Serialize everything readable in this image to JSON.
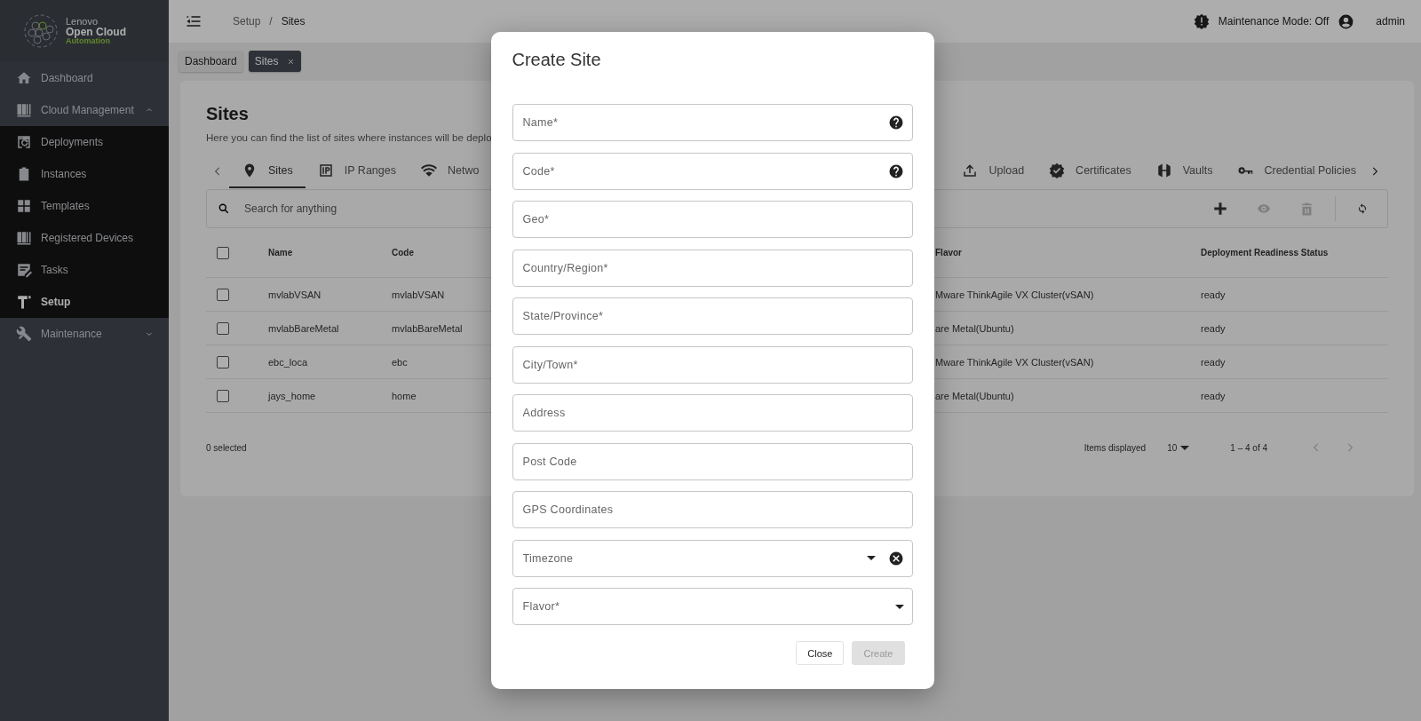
{
  "sidebar": {
    "logo": {
      "line_1": "Lenovo",
      "line_2": "Open Cloud",
      "line_3": "Automation"
    },
    "items": [
      {
        "label": "Dashboard",
        "selected": false
      },
      {
        "label": "Cloud Management",
        "selected": false,
        "expanded": true,
        "children": [
          {
            "label": "Deployments",
            "selected": false
          },
          {
            "label": "Instances",
            "selected": false
          },
          {
            "label": "Templates",
            "selected": false
          },
          {
            "label": "Registered Devices",
            "selected": false
          },
          {
            "label": "Tasks",
            "selected": false
          },
          {
            "label": "Setup",
            "selected": true
          }
        ]
      },
      {
        "label": "Maintenance",
        "selected": false,
        "expanded": false
      }
    ]
  },
  "header": {
    "breadcrumb": [
      "Setup",
      "Sites"
    ],
    "separator": "/",
    "maintenance": "Maintenance Mode: Off",
    "user": "admin"
  },
  "open_tabs": [
    {
      "label": "Dashboard",
      "selected": false,
      "closable": false
    },
    {
      "label": "Sites",
      "selected": true,
      "closable": true
    }
  ],
  "page": {
    "title": "Sites",
    "description": "Here you can find the list of sites where instances will be deplo",
    "tab_bar": {
      "left": [
        {
          "label": "Sites",
          "selected": true
        },
        {
          "label": "IP Ranges",
          "selected": false
        },
        {
          "label": "Netwo",
          "selected": false
        }
      ],
      "right": [
        {
          "label": "Upload",
          "selected": false
        },
        {
          "label": "Certificates",
          "selected": false
        },
        {
          "label": "Vaults",
          "selected": false
        },
        {
          "label": "Credential Policies",
          "selected": false
        }
      ]
    },
    "search": {
      "placeholder": "Search for anything"
    },
    "table": {
      "all_selected": false,
      "columns_left": [
        "Name",
        "Code"
      ],
      "columns_right": [
        "Flavor",
        "Deployment Readiness Status"
      ],
      "rows": [
        {
          "selected": false,
          "name": "mvlabVSAN",
          "code": "mvlabVSAN",
          "flavor": "Mware ThinkAgile VX Cluster(vSAN)",
          "status": "ready"
        },
        {
          "selected": false,
          "name": "mvlabBareMetal",
          "code": "mvlabBareMetal",
          "flavor": "are Metal(Ubuntu)",
          "status": "ready"
        },
        {
          "selected": false,
          "name": "ebc_loca",
          "code": "ebc",
          "flavor": "Mware ThinkAgile VX Cluster(vSAN)",
          "status": "ready"
        },
        {
          "selected": false,
          "name": "jays_home",
          "code": "home",
          "flavor": "are Metal(Ubuntu)",
          "status": "ready"
        }
      ]
    },
    "footer": {
      "selected_count": "0 selected",
      "items_label": "Items displayed",
      "page_size": "10",
      "range": "1 – 4 of 4"
    }
  },
  "dialog": {
    "title": "Create Site",
    "fields": [
      {
        "kind": "help",
        "placeholder": "Name*"
      },
      {
        "kind": "help",
        "placeholder": "Code*"
      },
      {
        "kind": "text",
        "placeholder": "Geo*"
      },
      {
        "kind": "text",
        "placeholder": "Country/Region*"
      },
      {
        "kind": "text",
        "placeholder": "State/Province*"
      },
      {
        "kind": "text",
        "placeholder": "City/Town*"
      },
      {
        "kind": "text",
        "placeholder": "Address"
      },
      {
        "kind": "text",
        "placeholder": "Post Code"
      },
      {
        "kind": "text",
        "placeholder": "GPS Coordinates"
      },
      {
        "kind": "clearable",
        "placeholder": "Timezone"
      },
      {
        "kind": "select",
        "placeholder": "Flavor*"
      }
    ],
    "buttons": [
      {
        "label": "Close",
        "disabled": false
      },
      {
        "label": "Create",
        "disabled": true
      }
    ]
  }
}
